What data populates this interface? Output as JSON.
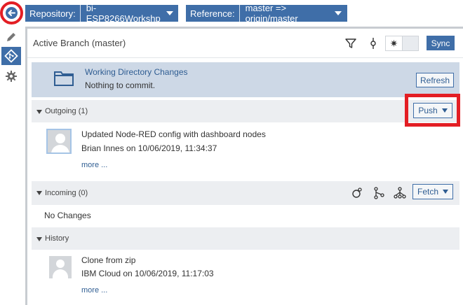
{
  "toolbar": {
    "repository_label": "Repository:",
    "repository_value": "bi-ESP8266Workshp",
    "reference_label": "Reference:",
    "reference_value": "master => origin/master"
  },
  "branch_bar": {
    "title": "Active Branch (master)",
    "toggle_symbol": "✷",
    "sync_label": "Sync"
  },
  "working_dir": {
    "title": "Working Directory Changes",
    "status": "Nothing to commit.",
    "refresh_label": "Refresh"
  },
  "outgoing": {
    "title": "Outgoing (1)",
    "push_label": "Push",
    "commit": {
      "message": "Updated Node-RED config with dashboard nodes",
      "author_line": "Brian Innes on 10/06/2019, 11:34:37",
      "more_label": "more ..."
    }
  },
  "incoming": {
    "title": "Incoming (0)",
    "fetch_label": "Fetch",
    "empty_text": "No Changes"
  },
  "history": {
    "title": "History",
    "commit": {
      "message": "Clone from zip",
      "author_line": "IBM Cloud on 10/06/2019, 11:17:03",
      "more_label": "more ..."
    }
  },
  "colors": {
    "accent": "#3f6ea8",
    "highlight_red": "#e31e24",
    "wdc_background": "#cdd8e6"
  },
  "icons": [
    "back-arrow-icon",
    "pencil-icon",
    "git-icon",
    "gear-icon",
    "filter-icon",
    "commit-icon",
    "folder-icon",
    "merge-icon",
    "rebase-icon",
    "pull-icon"
  ]
}
